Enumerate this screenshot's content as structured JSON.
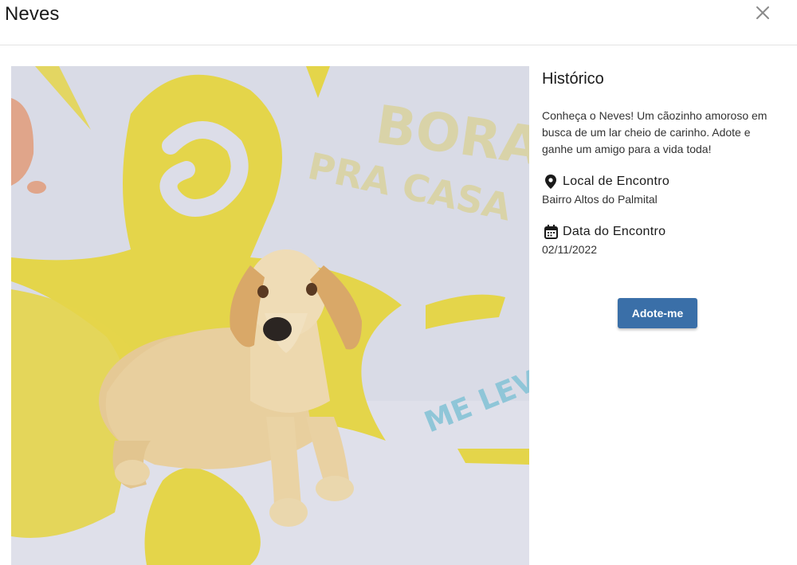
{
  "modal": {
    "title": "Neves",
    "close_icon": "close-icon"
  },
  "photo": {
    "alt": "Neves",
    "backdrop_text_line1": "BORA",
    "backdrop_text_line2": "PRA CASA",
    "backdrop_text_line3": "ME LEVA",
    "colors": {
      "backdrop": "#dcdde8",
      "yellow": "#e4d54a",
      "dog_fur": "#e8cf9e",
      "blue_text": "#8fc6d8"
    }
  },
  "details": {
    "section_title": "Histórico",
    "description": "Conheça o Neves! Um cãozinho amoroso em busca de um lar cheio de carinho. Adote e ganhe um amigo para a vida toda!",
    "location": {
      "icon": "map-pin-icon",
      "label": "Local de Encontro",
      "value": "Bairro Altos do Palmital"
    },
    "date": {
      "icon": "calendar-icon",
      "label": "Data do Encontro",
      "value": "02/11/2022"
    }
  },
  "actions": {
    "adopt_label": "Adote-me",
    "adopt_color": "#3a6fa8"
  }
}
